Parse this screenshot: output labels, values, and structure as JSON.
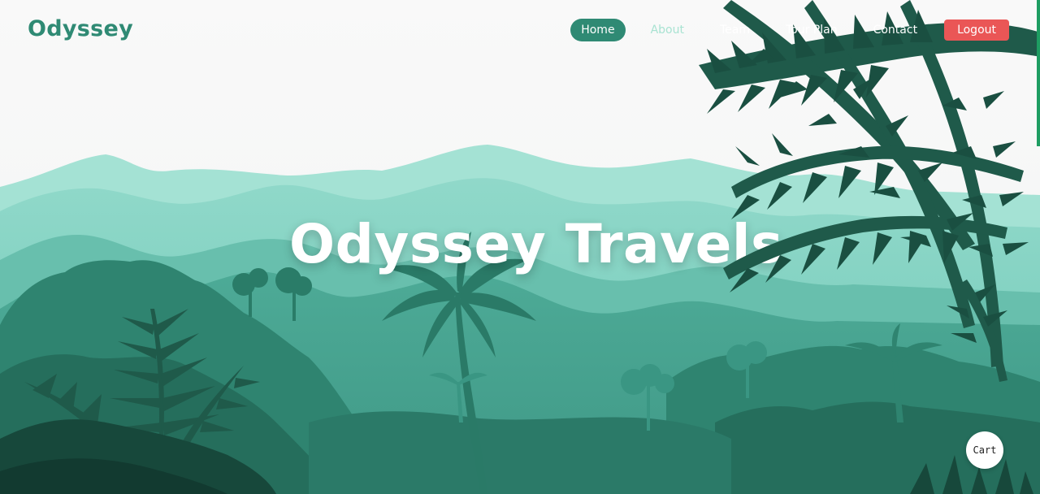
{
  "brand": {
    "logo": "Odyssey"
  },
  "nav": {
    "items": [
      {
        "label": "Home",
        "state": "active"
      },
      {
        "label": "About",
        "state": "faded"
      },
      {
        "label": "Team",
        "state": "normal"
      },
      {
        "label": "Tour Plan",
        "state": "normal"
      },
      {
        "label": "Contact",
        "state": "normal"
      }
    ],
    "logout_label": "Logout"
  },
  "hero": {
    "title": "Odyssey Travels"
  },
  "cart": {
    "label": "Cart"
  },
  "colors": {
    "brand": "#2f8a74",
    "logout": "#ea5656",
    "sky": "#f7f7f7",
    "scroll_indicator": "#1e9d62"
  }
}
